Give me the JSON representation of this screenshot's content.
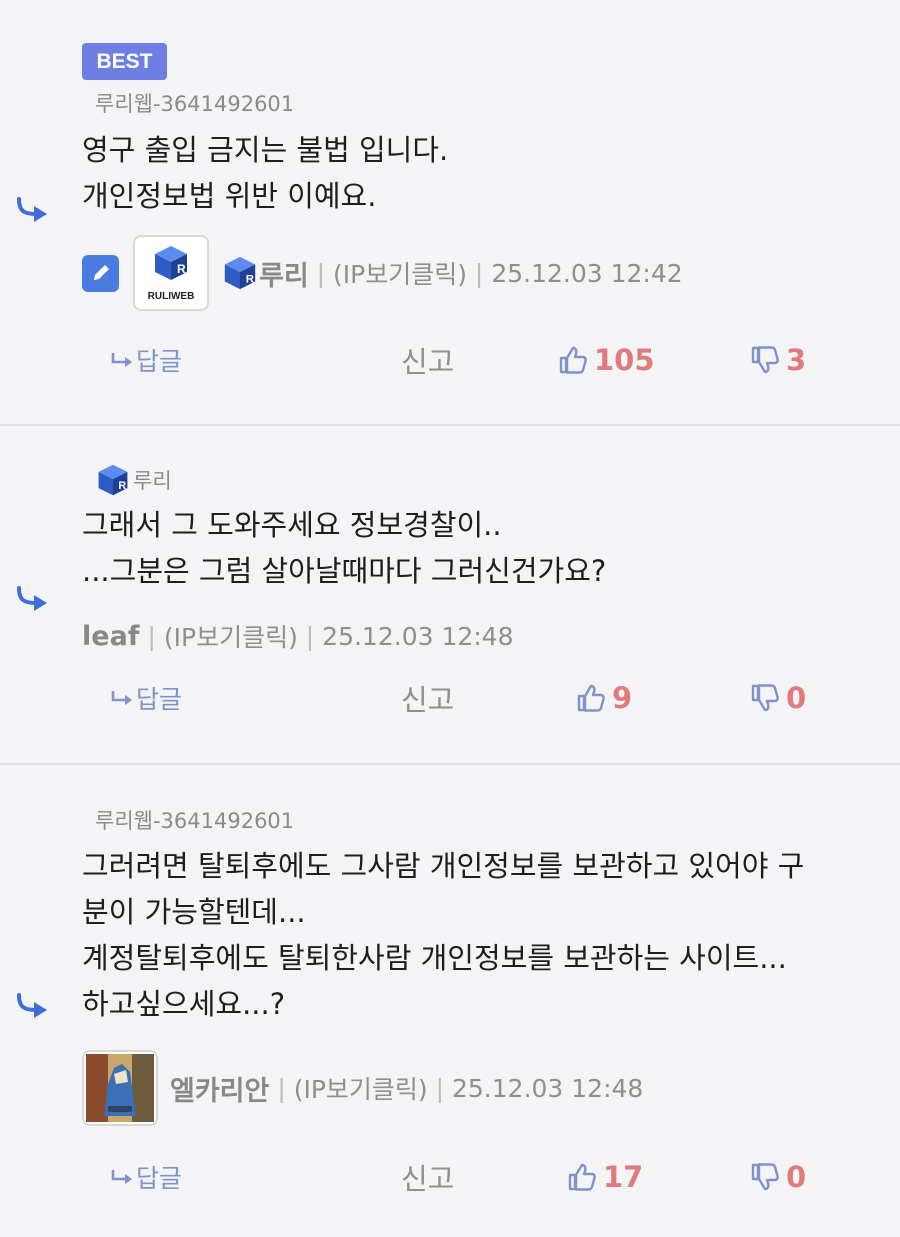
{
  "comments": [
    {
      "badge": "BEST",
      "target": "루리웹-3641492601",
      "lines": [
        "영구 출입 금지는 불법 입니다.",
        "개인정보법 위반 이예요."
      ],
      "author": "루리",
      "avatar_label": "RULIWEB",
      "ip_link": "(IP보기클릭)",
      "date": "25.12.03 12:42",
      "reply_label": "답글",
      "report_label": "신고",
      "likes": "105",
      "dislikes": "3"
    },
    {
      "target": "루리",
      "lines": [
        "그래서 그 도와주세요 정보경찰이..",
        "...그분은 그럼 살아날때마다 그러신건가요?"
      ],
      "author": "leaf",
      "ip_link": "(IP보기클릭)",
      "date": "25.12.03 12:48",
      "reply_label": "답글",
      "report_label": "신고",
      "likes": "9",
      "dislikes": "0"
    },
    {
      "target": "루리웹-3641492601",
      "lines": [
        "그러려면 탈퇴후에도 그사람 개인정보를 보관하고 있어야 구",
        "분이 가능할텐데...",
        "계정탈퇴후에도 탈퇴한사람 개인정보를 보관하는 사이트...",
        "하고싶으세요...?"
      ],
      "author": "엘카리안",
      "ip_link": "(IP보기클릭)",
      "date": "25.12.03 12:48",
      "reply_label": "답글",
      "report_label": "신고",
      "likes": "17",
      "dislikes": "0"
    }
  ],
  "colors": {
    "accent": "#4a7be0",
    "badge": "#6f7ee3",
    "vote": "#e07b7b",
    "reply": "#7d93c9"
  },
  "icons": {
    "reply_arrow": "reply-arrow-icon",
    "edit": "pencil-icon",
    "like": "thumbs-up-icon",
    "dislike": "thumbs-down-icon"
  }
}
